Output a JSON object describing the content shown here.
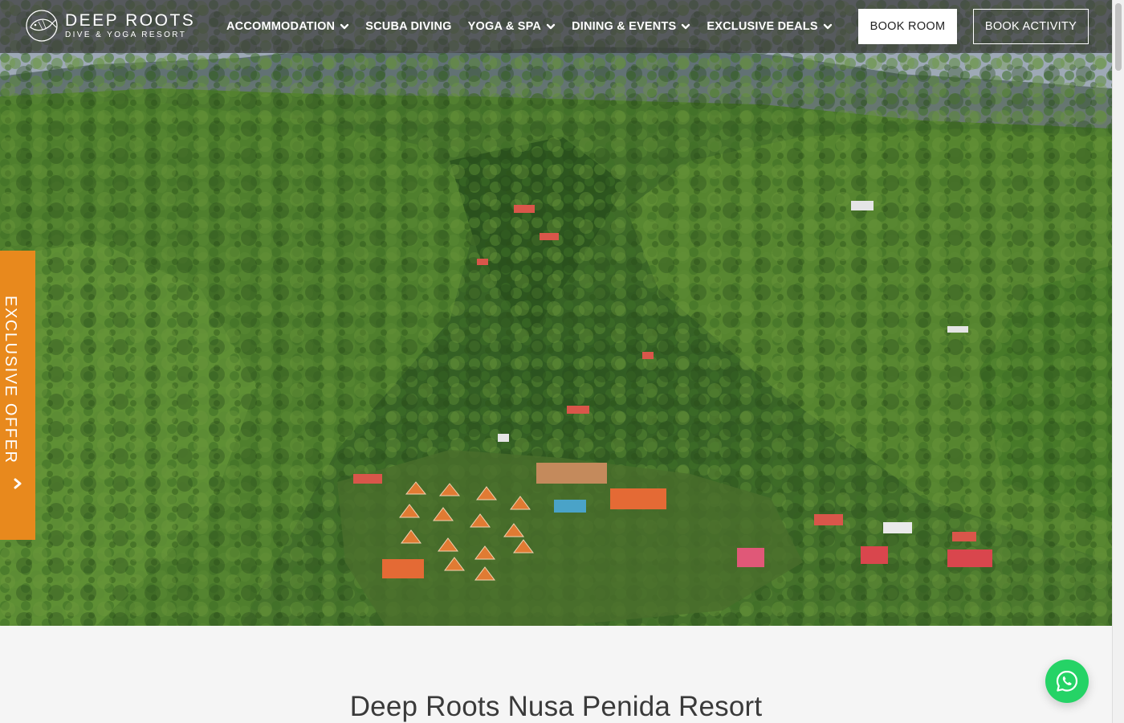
{
  "brand": {
    "name": "DEEP ROOTS",
    "tagline": "DIVE & YOGA RESORT"
  },
  "nav": {
    "items": [
      {
        "label": "ACCOMMODATION",
        "has_dropdown": true
      },
      {
        "label": "SCUBA DIVING",
        "has_dropdown": false
      },
      {
        "label": "YOGA & SPA",
        "has_dropdown": true
      },
      {
        "label": "DINING & EVENTS",
        "has_dropdown": true
      },
      {
        "label": "EXCLUSIVE DEALS",
        "has_dropdown": true
      }
    ]
  },
  "buttons": {
    "book_room": "BOOK ROOM",
    "book_activity": "BOOK ACTIVITY"
  },
  "offer_tab": {
    "label": "EXCLUSIVE OFFER",
    "icon": "chevron-right-icon"
  },
  "main": {
    "title": "Deep Roots Nusa Penida Resort"
  },
  "whatsapp": {
    "icon": "whatsapp-icon"
  },
  "colors": {
    "header_overlay": "#3c3c3c",
    "offer_orange": "#e8891d",
    "whatsapp_green": "#25d366",
    "page_bg": "#f5f5f5"
  }
}
